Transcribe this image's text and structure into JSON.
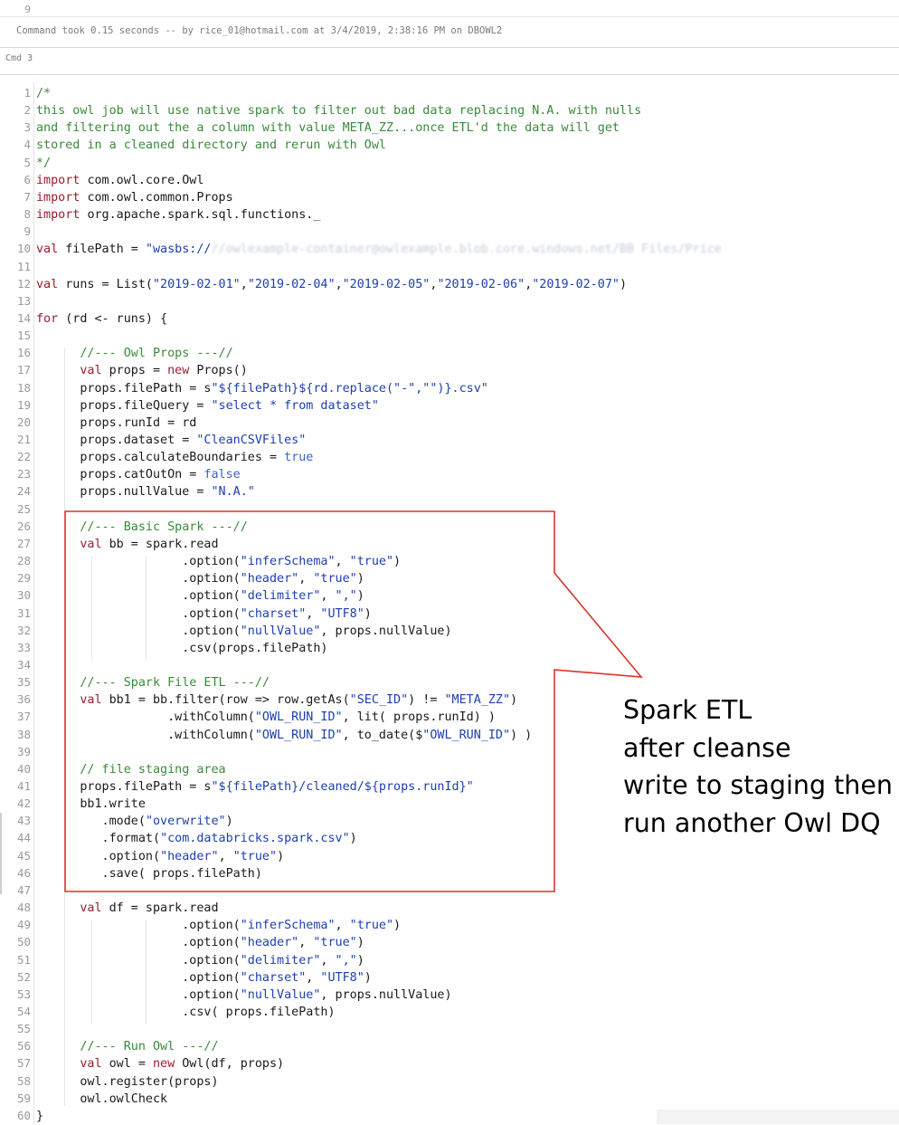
{
  "previous_cell": {
    "line_number": "9"
  },
  "cell_status": {
    "command_took": "Command took 0.15 seconds -- by rice_01@hotmail.com at 3/4/2019, 2:38:16 PM on DBOWL2"
  },
  "cell": {
    "label": "Cmd 3"
  },
  "annotation": {
    "lines": [
      "Spark ETL",
      "after cleanse",
      "write to staging then",
      "run another Owl DQ"
    ],
    "border_color": "#d9342b"
  },
  "code_lines": [
    {
      "n": "1",
      "segs": [
        [
          "c",
          "/*"
        ]
      ]
    },
    {
      "n": "2",
      "segs": [
        [
          "c",
          "this owl job will use native spark to filter out bad data replacing N.A. with nulls"
        ]
      ]
    },
    {
      "n": "3",
      "segs": [
        [
          "c",
          "and filtering out the a column with value META_ZZ...once ETL'd the data will get"
        ]
      ]
    },
    {
      "n": "4",
      "segs": [
        [
          "c",
          "stored in a cleaned directory and rerun with Owl"
        ]
      ]
    },
    {
      "n": "5",
      "segs": [
        [
          "c",
          "*/"
        ]
      ]
    },
    {
      "n": "6",
      "segs": [
        [
          "k",
          "import"
        ],
        [
          "",
          "com.owl.core.Owl"
        ]
      ]
    },
    {
      "n": "7",
      "segs": [
        [
          "k",
          "import"
        ],
        [
          "",
          "com.owl.common.Props"
        ]
      ]
    },
    {
      "n": "8",
      "segs": [
        [
          "k",
          "import"
        ],
        [
          "",
          "org.apache.spark.sql.functions._"
        ]
      ]
    },
    {
      "n": "9",
      "segs": []
    },
    {
      "n": "10",
      "segs": [
        [
          "k",
          "val"
        ],
        [
          "",
          "filePath = "
        ],
        [
          "s",
          "\"wasbs://"
        ],
        [
          "blur",
          "//owlexample-container@owlexample.blob.core.windows.net/BB Files/Price"
        ]
      ]
    },
    {
      "n": "11",
      "segs": []
    },
    {
      "n": "12",
      "segs": [
        [
          "k",
          "val"
        ],
        [
          "",
          "runs = List("
        ],
        [
          "s",
          "\"2019-02-01\""
        ],
        [
          "",
          ","
        ],
        [
          "s",
          "\"2019-02-04\""
        ],
        [
          "",
          ","
        ],
        [
          "s",
          "\"2019-02-05\""
        ],
        [
          "",
          ","
        ],
        [
          "s",
          "\"2019-02-06\""
        ],
        [
          "",
          ","
        ],
        [
          "s",
          "\"2019-02-07\""
        ],
        [
          "",
          ")"
        ]
      ]
    },
    {
      "n": "13",
      "segs": []
    },
    {
      "n": "14",
      "segs": [
        [
          "k",
          "for"
        ],
        [
          "",
          "(rd <- runs) {"
        ]
      ]
    },
    {
      "n": "15",
      "segs": []
    },
    {
      "n": "16",
      "segs": [
        [
          "",
          "      "
        ],
        [
          "c",
          "//--- Owl Props ---//"
        ]
      ]
    },
    {
      "n": "17",
      "segs": [
        [
          "",
          "      "
        ],
        [
          "k",
          "val"
        ],
        [
          "",
          "props = "
        ],
        [
          "k",
          "new"
        ],
        [
          "",
          "Props()"
        ]
      ]
    },
    {
      "n": "18",
      "segs": [
        [
          "",
          "      props.filePath = s"
        ],
        [
          "s",
          "\"${filePath}${rd.replace(\"-\",\"\")}.csv\""
        ]
      ]
    },
    {
      "n": "19",
      "segs": [
        [
          "",
          "      props.fileQuery = "
        ],
        [
          "s",
          "\"select * from dataset\""
        ]
      ]
    },
    {
      "n": "20",
      "segs": [
        [
          "",
          "      props.runId = rd"
        ]
      ]
    },
    {
      "n": "21",
      "segs": [
        [
          "",
          "      props.dataset = "
        ],
        [
          "s",
          "\"CleanCSVFiles\""
        ]
      ]
    },
    {
      "n": "22",
      "segs": [
        [
          "",
          "      props.calculateBoundaries = "
        ],
        [
          "b",
          "true"
        ]
      ]
    },
    {
      "n": "23",
      "segs": [
        [
          "",
          "      props.catOutOn = "
        ],
        [
          "b",
          "false"
        ]
      ]
    },
    {
      "n": "24",
      "segs": [
        [
          "",
          "      props.nullValue = "
        ],
        [
          "s",
          "\"N.A.\""
        ]
      ]
    },
    {
      "n": "25",
      "segs": []
    },
    {
      "n": "26",
      "segs": [
        [
          "",
          "      "
        ],
        [
          "c",
          "//--- Basic Spark ---//"
        ]
      ]
    },
    {
      "n": "27",
      "segs": [
        [
          "",
          "      "
        ],
        [
          "k",
          "val"
        ],
        [
          "",
          "bb = spark.read"
        ]
      ]
    },
    {
      "n": "28",
      "segs": [
        [
          "",
          "                    .option("
        ],
        [
          "s",
          "\"inferSchema\""
        ],
        [
          "",
          ", "
        ],
        [
          "s",
          "\"true\""
        ],
        [
          "",
          ")"
        ]
      ]
    },
    {
      "n": "29",
      "segs": [
        [
          "",
          "                    .option("
        ],
        [
          "s",
          "\"header\""
        ],
        [
          "",
          ", "
        ],
        [
          "s",
          "\"true\""
        ],
        [
          "",
          ")"
        ]
      ]
    },
    {
      "n": "30",
      "segs": [
        [
          "",
          "                    .option("
        ],
        [
          "s",
          "\"delimiter\""
        ],
        [
          "",
          ", "
        ],
        [
          "s",
          "\",\""
        ],
        [
          "",
          ")"
        ]
      ]
    },
    {
      "n": "31",
      "segs": [
        [
          "",
          "                    .option("
        ],
        [
          "s",
          "\"charset\""
        ],
        [
          "",
          ", "
        ],
        [
          "s",
          "\"UTF8\""
        ],
        [
          "",
          ")"
        ]
      ]
    },
    {
      "n": "32",
      "segs": [
        [
          "",
          "                    .option("
        ],
        [
          "s",
          "\"nullValue\""
        ],
        [
          "",
          ", props.nullValue)"
        ]
      ]
    },
    {
      "n": "33",
      "segs": [
        [
          "",
          "                    .csv(props.filePath)"
        ]
      ]
    },
    {
      "n": "34",
      "segs": []
    },
    {
      "n": "35",
      "segs": [
        [
          "",
          "      "
        ],
        [
          "c",
          "//--- Spark File ETL ---//"
        ]
      ]
    },
    {
      "n": "36",
      "segs": [
        [
          "",
          "      "
        ],
        [
          "k",
          "val"
        ],
        [
          "",
          "bb1 = bb.filter(row => row.getAs("
        ],
        [
          "s",
          "\"SEC_ID\""
        ],
        [
          "",
          ") != "
        ],
        [
          "s",
          "\"META_ZZ\""
        ],
        [
          "",
          ")"
        ]
      ]
    },
    {
      "n": "37",
      "segs": [
        [
          "",
          "                  .withColumn("
        ],
        [
          "s",
          "\"OWL_RUN_ID\""
        ],
        [
          "",
          ", lit( props.runId) )"
        ]
      ]
    },
    {
      "n": "38",
      "segs": [
        [
          "",
          "                  .withColumn("
        ],
        [
          "s",
          "\"OWL_RUN_ID\""
        ],
        [
          "",
          ", to_date($"
        ],
        [
          "s",
          "\"OWL_RUN_ID\""
        ],
        [
          "",
          ") )"
        ]
      ]
    },
    {
      "n": "39",
      "segs": []
    },
    {
      "n": "40",
      "segs": [
        [
          "",
          "      "
        ],
        [
          "c",
          "// file staging area"
        ]
      ]
    },
    {
      "n": "41",
      "segs": [
        [
          "",
          "      props.filePath = s"
        ],
        [
          "s",
          "\"${filePath}/cleaned/${props.runId}\""
        ]
      ]
    },
    {
      "n": "42",
      "segs": [
        [
          "",
          "      bb1.write"
        ]
      ]
    },
    {
      "n": "43",
      "segs": [
        [
          "",
          "         .mode("
        ],
        [
          "s",
          "\"overwrite\""
        ],
        [
          "",
          ")"
        ]
      ]
    },
    {
      "n": "44",
      "segs": [
        [
          "",
          "         .format("
        ],
        [
          "s",
          "\"com.databricks.spark.csv\""
        ],
        [
          "",
          ")"
        ]
      ]
    },
    {
      "n": "45",
      "segs": [
        [
          "",
          "         .option("
        ],
        [
          "s",
          "\"header\""
        ],
        [
          "",
          ", "
        ],
        [
          "s",
          "\"true\""
        ],
        [
          "",
          ")"
        ]
      ]
    },
    {
      "n": "46",
      "segs": [
        [
          "",
          "         .save( props.filePath)"
        ]
      ]
    },
    {
      "n": "47",
      "segs": []
    },
    {
      "n": "48",
      "segs": [
        [
          "",
          "      "
        ],
        [
          "k",
          "val"
        ],
        [
          "",
          "df = spark.read"
        ]
      ]
    },
    {
      "n": "49",
      "segs": [
        [
          "",
          "                    .option("
        ],
        [
          "s",
          "\"inferSchema\""
        ],
        [
          "",
          ", "
        ],
        [
          "s",
          "\"true\""
        ],
        [
          "",
          ")"
        ]
      ]
    },
    {
      "n": "50",
      "segs": [
        [
          "",
          "                    .option("
        ],
        [
          "s",
          "\"header\""
        ],
        [
          "",
          ", "
        ],
        [
          "s",
          "\"true\""
        ],
        [
          "",
          ")"
        ]
      ]
    },
    {
      "n": "51",
      "segs": [
        [
          "",
          "                    .option("
        ],
        [
          "s",
          "\"delimiter\""
        ],
        [
          "",
          ", "
        ],
        [
          "s",
          "\",\""
        ],
        [
          "",
          ")"
        ]
      ]
    },
    {
      "n": "52",
      "segs": [
        [
          "",
          "                    .option("
        ],
        [
          "s",
          "\"charset\""
        ],
        [
          "",
          ", "
        ],
        [
          "s",
          "\"UTF8\""
        ],
        [
          "",
          ")"
        ]
      ]
    },
    {
      "n": "53",
      "segs": [
        [
          "",
          "                    .option("
        ],
        [
          "s",
          "\"nullValue\""
        ],
        [
          "",
          ", props.nullValue)"
        ]
      ]
    },
    {
      "n": "54",
      "segs": [
        [
          "",
          "                    .csv( props.filePath)"
        ]
      ]
    },
    {
      "n": "55",
      "segs": []
    },
    {
      "n": "56",
      "segs": [
        [
          "",
          "      "
        ],
        [
          "c",
          "//--- Run Owl ---//"
        ]
      ]
    },
    {
      "n": "57",
      "segs": [
        [
          "",
          "      "
        ],
        [
          "k",
          "val"
        ],
        [
          "",
          "owl = "
        ],
        [
          "k",
          "new"
        ],
        [
          "",
          "Owl(df, props)"
        ]
      ]
    },
    {
      "n": "58",
      "segs": [
        [
          "",
          "      owl.register(props)"
        ]
      ]
    },
    {
      "n": "59",
      "segs": [
        [
          "",
          "      owl.owlCheck"
        ]
      ]
    },
    {
      "n": "60",
      "segs": [
        [
          "",
          "}"
        ]
      ]
    }
  ]
}
